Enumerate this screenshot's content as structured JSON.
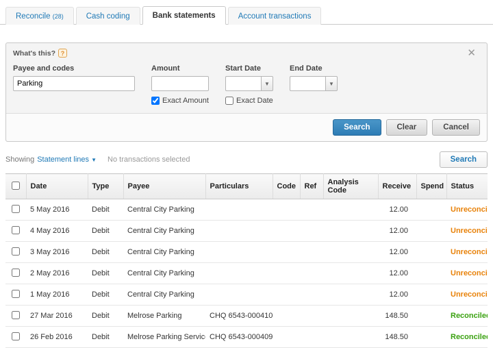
{
  "colors": {
    "accent_blue": "#1f79b6",
    "unreconciled": "#e8820a",
    "reconciled": "#3aa110",
    "button_blue": "#2d7cb5"
  },
  "icons": {
    "help": "?",
    "close": "✕",
    "caret": "▼"
  },
  "tabs": [
    {
      "label": "Reconcile",
      "count": "(28)"
    },
    {
      "label": "Cash coding",
      "count": ""
    },
    {
      "label": "Bank statements",
      "count": ""
    },
    {
      "label": "Account transactions",
      "count": ""
    }
  ],
  "search_panel": {
    "whats_this": "What's this?",
    "fields": {
      "payee_label": "Payee and codes",
      "payee_value": "Parking",
      "amount_label": "Amount",
      "amount_value": "",
      "exact_amount_label": "Exact Amount",
      "exact_amount_checked": "checked",
      "start_date_label": "Start Date",
      "start_date_value": "",
      "exact_date_label": "Exact Date",
      "end_date_label": "End Date",
      "end_date_value": ""
    },
    "buttons": {
      "search": "Search",
      "clear": "Clear",
      "cancel": "Cancel"
    }
  },
  "toolbar": {
    "showing": "Showing",
    "statement_lines": "Statement lines",
    "no_selection": "No transactions selected",
    "search": "Search"
  },
  "table": {
    "headers": {
      "date": "Date",
      "type": "Type",
      "payee": "Payee",
      "particulars": "Particulars",
      "code": "Code",
      "ref": "Ref",
      "analysis_code": "Analysis Code",
      "receive": "Receive",
      "spend": "Spend",
      "status": "Status"
    },
    "rows": [
      {
        "date": "5 May 2016",
        "type": "Debit",
        "payee": "Central City Parking",
        "particulars": "",
        "code": "",
        "ref": "",
        "analysis_code": "",
        "receive": "12.00",
        "spend": "",
        "status": "Unreconciled"
      },
      {
        "date": "4 May 2016",
        "type": "Debit",
        "payee": "Central City Parking",
        "particulars": "",
        "code": "",
        "ref": "",
        "analysis_code": "",
        "receive": "12.00",
        "spend": "",
        "status": "Unreconciled"
      },
      {
        "date": "3 May 2016",
        "type": "Debit",
        "payee": "Central City Parking",
        "particulars": "",
        "code": "",
        "ref": "",
        "analysis_code": "",
        "receive": "12.00",
        "spend": "",
        "status": "Unreconciled"
      },
      {
        "date": "2 May 2016",
        "type": "Debit",
        "payee": "Central City Parking",
        "particulars": "",
        "code": "",
        "ref": "",
        "analysis_code": "",
        "receive": "12.00",
        "spend": "",
        "status": "Unreconciled"
      },
      {
        "date": "1 May 2016",
        "type": "Debit",
        "payee": "Central City Parking",
        "particulars": "",
        "code": "",
        "ref": "",
        "analysis_code": "",
        "receive": "12.00",
        "spend": "",
        "status": "Unreconciled"
      },
      {
        "date": "27 Mar 2016",
        "type": "Debit",
        "payee": "Melrose Parking",
        "particulars": "CHQ 6543-000410",
        "code": "",
        "ref": "",
        "analysis_code": "",
        "receive": "148.50",
        "spend": "",
        "status": "Reconciled"
      },
      {
        "date": "26 Feb 2016",
        "type": "Debit",
        "payee": "Melrose Parking Services",
        "particulars": "CHQ 6543-000409",
        "code": "",
        "ref": "",
        "analysis_code": "",
        "receive": "148.50",
        "spend": "",
        "status": "Reconciled"
      }
    ]
  }
}
